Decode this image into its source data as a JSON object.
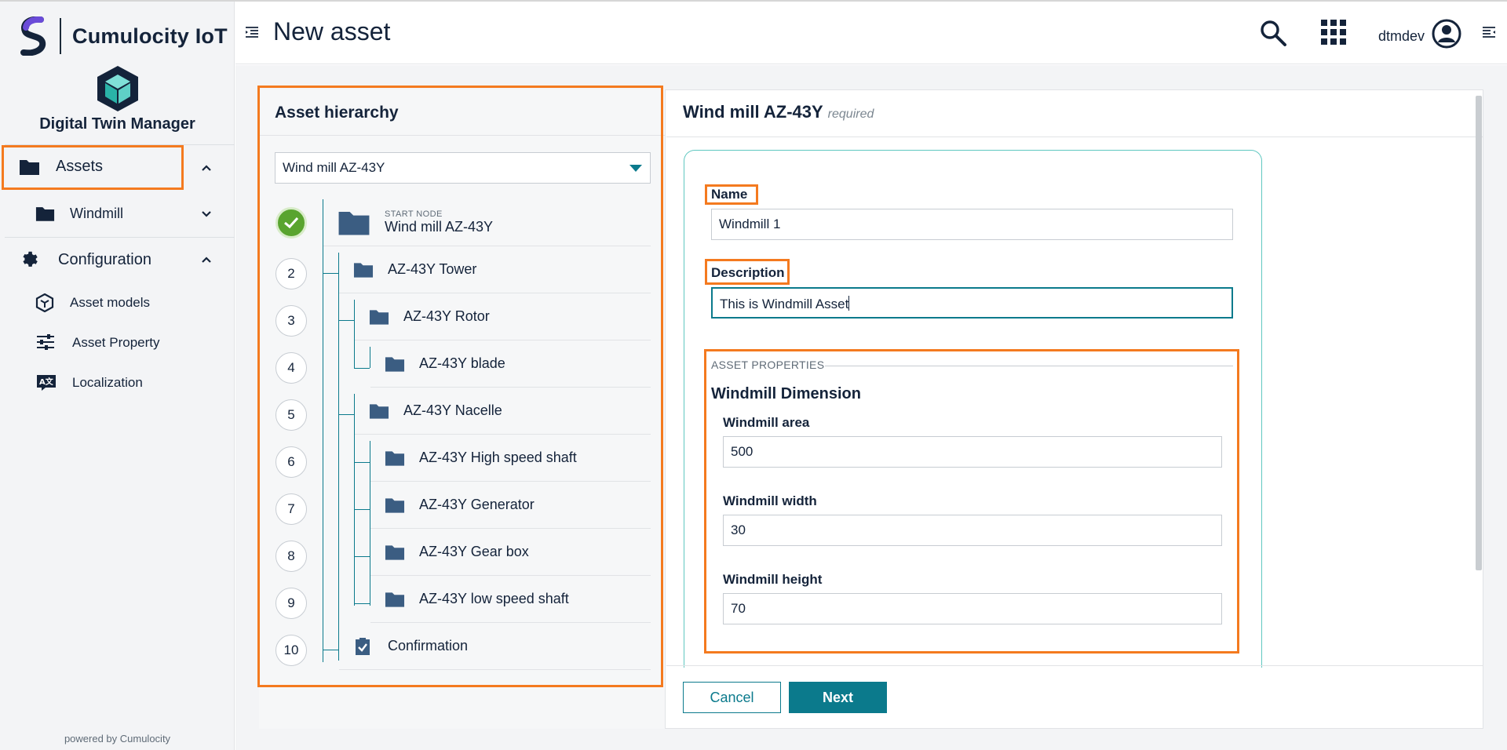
{
  "brand": {
    "name": "Cumulocity IoT"
  },
  "app": {
    "name": "Digital Twin Manager"
  },
  "sidebar": {
    "items": [
      {
        "label": "Assets"
      },
      {
        "label": "Windmill"
      },
      {
        "label": "Configuration"
      },
      {
        "label": "Asset models"
      },
      {
        "label": "Asset Property"
      },
      {
        "label": "Localization"
      }
    ],
    "powered_by": "powered by Cumulocity"
  },
  "header": {
    "title": "New asset",
    "user": "dtmdev"
  },
  "hierarchy": {
    "title": "Asset hierarchy",
    "selected": "Wind mill AZ-43Y",
    "start_tag": "START NODE",
    "start_node": "Wind mill AZ-43Y",
    "steps": [
      "2",
      "3",
      "4",
      "5",
      "6",
      "7",
      "8",
      "9",
      "10"
    ],
    "nodes": [
      "AZ-43Y Tower",
      "AZ-43Y Rotor",
      "AZ-43Y blade",
      "AZ-43Y Nacelle",
      "AZ-43Y High speed shaft",
      "AZ-43Y Generator",
      "AZ-43Y Gear box",
      "AZ-43Y low speed shaft",
      "Confirmation"
    ]
  },
  "form": {
    "title": "Wind mill AZ-43Y",
    "required": "required",
    "name_label": "Name",
    "name_value": "Windmill 1",
    "desc_label": "Description",
    "desc_value": "This is Windmill Asset",
    "section": "ASSET PROPERTIES",
    "group": "Windmill Dimension",
    "area_label": "Windmill area",
    "area_value": "500",
    "width_label": "Windmill width",
    "width_value": "30",
    "height_label": "Windmill height",
    "height_value": "70"
  },
  "buttons": {
    "cancel": "Cancel",
    "next": "Next"
  },
  "colors": {
    "accent": "#0b7a8c",
    "highlight": "#f47a1f",
    "success": "#59a42f",
    "navy": "#14233a"
  }
}
